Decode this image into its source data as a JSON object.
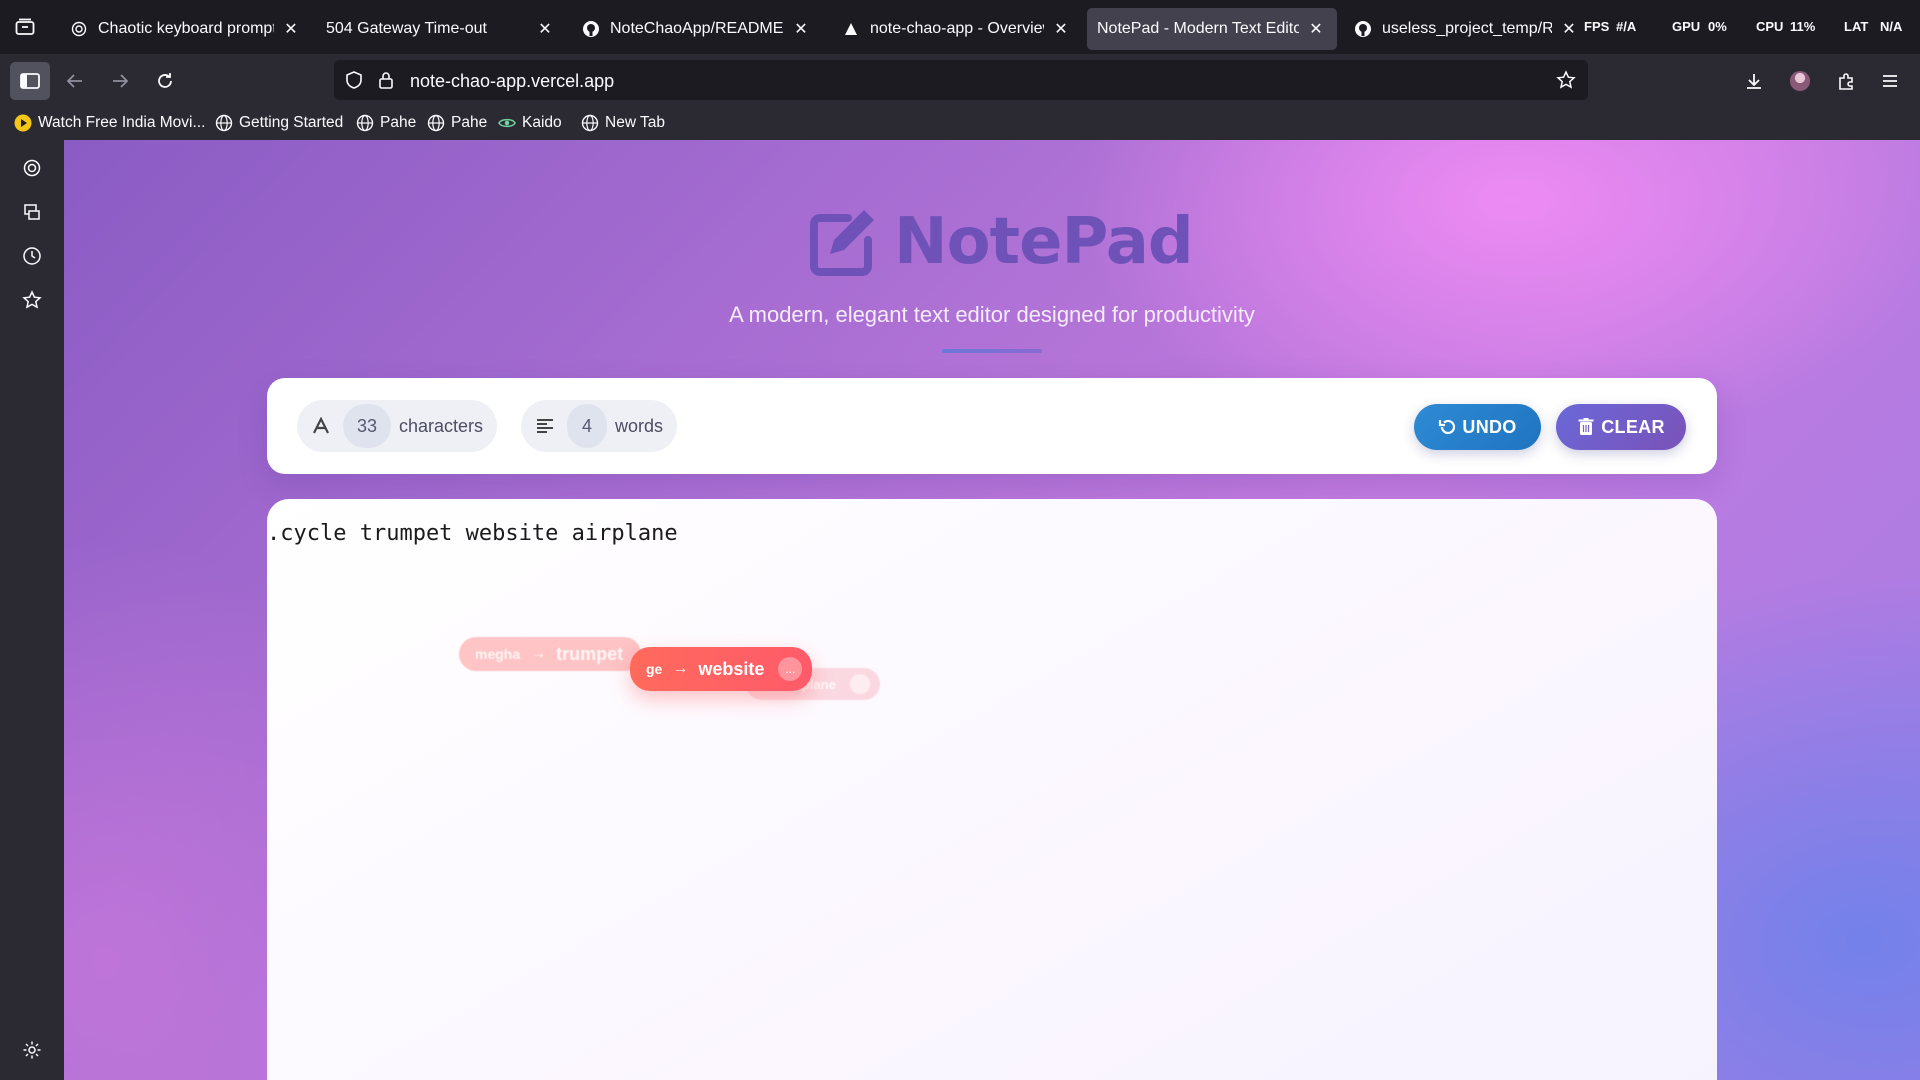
{
  "browser": {
    "tabs": [
      {
        "title": "Chaotic keyboard prompt",
        "icon": "openai-icon",
        "active": false
      },
      {
        "title": "504 Gateway Time-out",
        "icon": "",
        "active": false
      },
      {
        "title": "NoteChaoApp/README.md",
        "icon": "github-icon",
        "active": false
      },
      {
        "title": "note-chao-app - Overview -",
        "icon": "vercel-icon",
        "active": false
      },
      {
        "title": "NotePad - Modern Text Editor",
        "icon": "",
        "active": true
      },
      {
        "title": "useless_project_temp/READI",
        "icon": "github-icon",
        "active": false
      }
    ],
    "perf": {
      "fps_label": "FPS",
      "fps": "#/A",
      "gpu_label": "GPU",
      "gpu": "0%",
      "cpu_label": "CPU",
      "cpu": "11%",
      "lat_label": "LAT",
      "lat": "N/A"
    },
    "url": "note-chao-app.vercel.app",
    "bookmarks": [
      {
        "label": "Watch Free India Movi...",
        "icon": "play-icon"
      },
      {
        "label": "Getting Started",
        "icon": "globe-icon"
      },
      {
        "label": "Pahe",
        "icon": "globe-icon"
      },
      {
        "label": "Pahe",
        "icon": "globe-icon"
      },
      {
        "label": "Kaido",
        "icon": "eye-icon"
      },
      {
        "label": "New Tab",
        "icon": "globe-icon"
      }
    ]
  },
  "app": {
    "brand": "NotePad",
    "tagline": "A modern, elegant text editor designed for productivity",
    "stats": {
      "characters": {
        "value": "33",
        "label": "characters"
      },
      "words": {
        "value": "4",
        "label": "words"
      }
    },
    "buttons": {
      "undo": "UNDO",
      "clear": "CLEAR"
    },
    "editor_text": ".cycle trumpet website airplane",
    "chips": [
      {
        "from": "megha",
        "arrow": "→",
        "to": "trumpet"
      },
      {
        "from": "ge",
        "arrow": "→",
        "to": "website",
        "dot": "..."
      },
      {
        "from": "",
        "arrow": "",
        "to": "airplane"
      }
    ],
    "colors": {
      "brand": "#6f52b8",
      "undo": "#2f8ad4",
      "clear": "#6a68d8",
      "chip": "#ff6a5c"
    }
  }
}
